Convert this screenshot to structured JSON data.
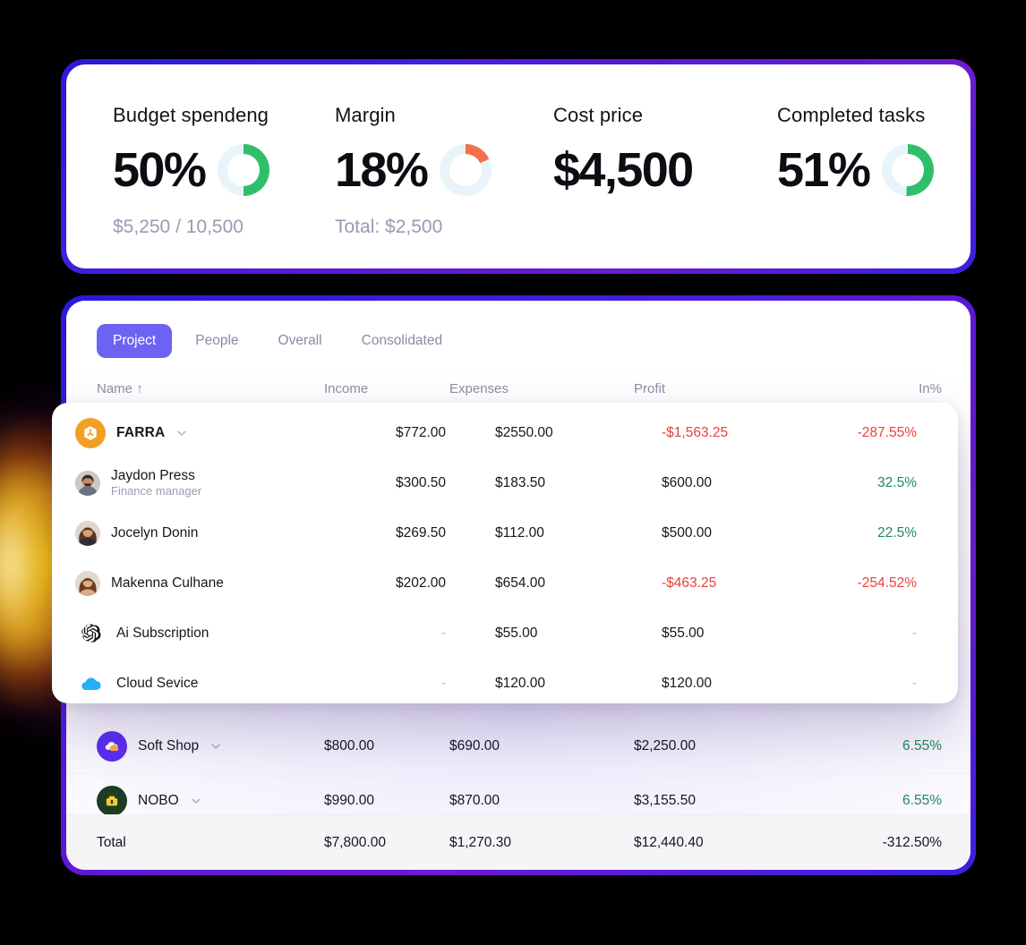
{
  "theme": {
    "page_bg": "#000000",
    "card_border_gradient_from": "#2a18d8",
    "card_border_gradient_to": "#6c1bd0",
    "accent": "#6c63f5",
    "positive": "#1f8a5a",
    "negative": "#e8413b",
    "muted": "#9a9ab0",
    "donut_track": "#e8f4f9",
    "donut_green": "#2fbf6a",
    "donut_orange": "#f4704a",
    "glow": "#ffd600"
  },
  "kpis": [
    {
      "title": "Budget spendeng",
      "value": "50%",
      "sub": "$5,250 / 10,500",
      "percent": 50,
      "color": "#2fbf6a",
      "has_donut": true
    },
    {
      "title": "Margin",
      "value": "18%",
      "sub": "Total: $2,500",
      "percent": 18,
      "color": "#f4704a",
      "has_donut": true
    },
    {
      "title": "Cost price",
      "value": "$4,500",
      "sub": "",
      "percent": 0,
      "color": "#2fbf6a",
      "has_donut": false
    },
    {
      "title": "Completed tasks",
      "value": "51%",
      "sub": "",
      "percent": 51,
      "color": "#2fbf6a",
      "has_donut": true
    }
  ],
  "tabs": [
    {
      "label": "Project",
      "active": true
    },
    {
      "label": "People",
      "active": false
    },
    {
      "label": "Overall",
      "active": false
    },
    {
      "label": "Consolidated",
      "active": false
    }
  ],
  "table": {
    "columns": {
      "name": "Name",
      "sort_glyph": "↑",
      "income": "Income",
      "expenses": "Expenses",
      "profit": "Profit",
      "percent": "In%"
    },
    "rows": [
      {
        "name": "Soft Shop",
        "icon": "soft-shop-logo",
        "expandable": true,
        "income": "$800.00",
        "expenses": "$690.00",
        "profit": "$2,250.00",
        "percent": "6.55%",
        "percent_sign": "positive",
        "profit_sign": "neutral"
      },
      {
        "name": "NOBO",
        "icon": "nobo-logo",
        "expandable": true,
        "income": "$990.00",
        "expenses": "$870.00",
        "profit": "$3,155.50",
        "percent": "6.55%",
        "percent_sign": "positive",
        "profit_sign": "neutral"
      }
    ],
    "total": {
      "label": "Total",
      "income": "$7,800.00",
      "expenses": "$1,270.30",
      "profit": "$12,440.40",
      "percent": "-312.50%"
    }
  },
  "overlay": {
    "rows": [
      {
        "name": "FARRA",
        "role": "",
        "icon": "farra-logo",
        "expandable": true,
        "income": "$772.00",
        "expenses": "$2550.00",
        "profit": "-$1,563.25",
        "percent": "-287.55%",
        "profit_sign": "negative",
        "percent_sign": "negative"
      },
      {
        "name": "Jaydon Press",
        "role": "Finance manager",
        "icon": "avatar-jaydon",
        "expandable": false,
        "income": "$300.50",
        "expenses": "$183.50",
        "profit": "$600.00",
        "percent": "32.5%",
        "profit_sign": "neutral",
        "percent_sign": "positive"
      },
      {
        "name": "Jocelyn Donin",
        "role": "",
        "icon": "avatar-jocelyn",
        "expandable": false,
        "income": "$269.50",
        "expenses": "$112.00",
        "profit": "$500.00",
        "percent": "22.5%",
        "profit_sign": "neutral",
        "percent_sign": "positive"
      },
      {
        "name": "Makenna Culhane",
        "role": "",
        "icon": "avatar-makenna",
        "expandable": false,
        "income": "$202.00",
        "expenses": "$654.00",
        "profit": "-$463.25",
        "percent": "-254.52%",
        "profit_sign": "negative",
        "percent_sign": "negative"
      },
      {
        "name": "Ai Subscription",
        "role": "",
        "icon": "openai-logo",
        "expandable": false,
        "income": "-",
        "expenses": "$55.00",
        "profit": "$55.00",
        "percent": "-",
        "profit_sign": "neutral",
        "percent_sign": "muted"
      },
      {
        "name": "Cloud Sevice",
        "role": "",
        "icon": "cloud-logo",
        "expandable": false,
        "income": "-",
        "expenses": "$120.00",
        "profit": "$120.00",
        "percent": "-",
        "profit_sign": "neutral",
        "percent_sign": "muted"
      }
    ]
  }
}
